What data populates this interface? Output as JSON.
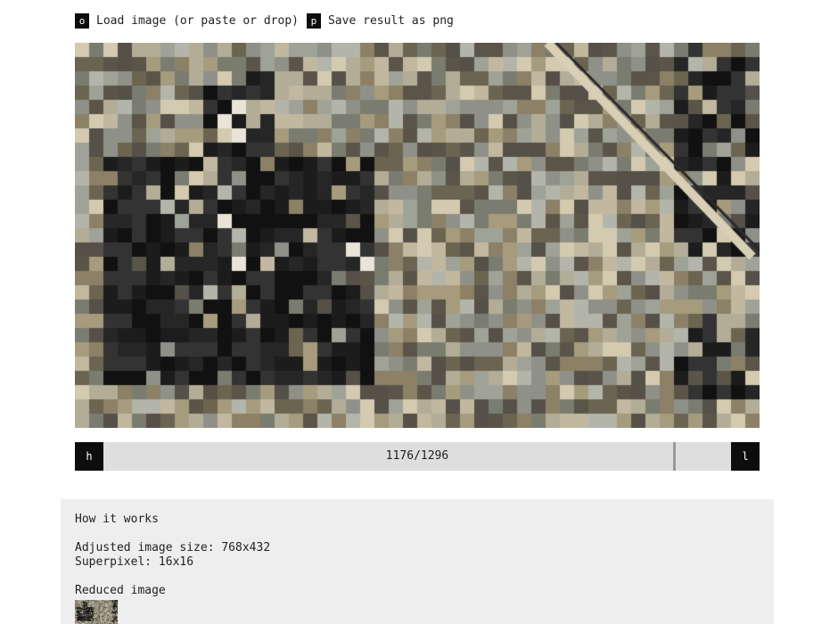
{
  "toolbar": {
    "load_key": "o",
    "load_label": "Load image (or paste or drop)",
    "save_key": "p",
    "save_label": "Save result as png"
  },
  "image": {
    "description_icon": "pixel-mosaic-image",
    "superpixels_revealed": 1176,
    "superpixels_total": 1296
  },
  "slider": {
    "prev_key": "h",
    "next_key": "l",
    "progress_label": "1176/1296",
    "progress_fraction": 0.907
  },
  "info": {
    "heading": "How it works",
    "adjusted_size": "Adjusted image size: 768x432",
    "superpixel": "Superpixel: 16x16",
    "reduced_heading": "Reduced image"
  },
  "colors": {
    "key_bg": "#0d0d0d",
    "slider_bg": "#dedede",
    "panel_bg": "#eeeeee",
    "palette": [
      "#a69b7d",
      "#8c8066",
      "#9fa296",
      "#7a7c70",
      "#6b6450",
      "#5a5548",
      "#c2b8a0",
      "#d4cab0",
      "#b3ad97",
      "#8f9189",
      "#b4b5aa",
      "#555048"
    ],
    "dark": [
      "#111111",
      "#1c1c1c",
      "#262626",
      "#333333"
    ]
  }
}
